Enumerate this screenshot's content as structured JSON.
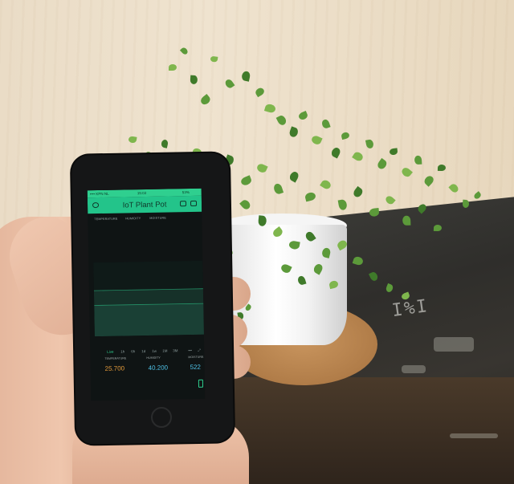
{
  "app": {
    "carrier": "•••• KPN NL",
    "time": "15:03",
    "battery": "53%",
    "title": "IoT Plant Pot"
  },
  "metric_tabs": [
    "TEMPERATURE",
    "HUMIDITY",
    "MOISTURE"
  ],
  "time_tabs": [
    "Live",
    "1h",
    "6h",
    "1d",
    "1w",
    "1M",
    "3M"
  ],
  "readouts": [
    {
      "label": "TEMPERATURE",
      "value": "25.700",
      "color": "#e29a3b"
    },
    {
      "label": "HUMIDITY",
      "value": "40.200",
      "color": "#4fc3e8"
    },
    {
      "label": "MOISTURE",
      "value": "522",
      "color": "#4fc3e8"
    }
  ],
  "colors": {
    "accent": "#23c48a",
    "chart_fill": "#1f4d3f",
    "chart_line": "#2fcf8f"
  },
  "chart_data": {
    "type": "area",
    "series": [
      {
        "values": [
          0.62,
          0.62,
          0.62,
          0.62,
          0.62,
          0.62,
          0.62,
          0.62
        ]
      },
      {
        "values": [
          0.42,
          0.42,
          0.42,
          0.42,
          0.42,
          0.42,
          0.42,
          0.42
        ]
      }
    ],
    "ylim": [
      0,
      1
    ]
  },
  "icons": [
    "clock-icon",
    "fullscreen-icon",
    "square-icon",
    "more-icon",
    "expand-icon",
    "phone-icon"
  ]
}
